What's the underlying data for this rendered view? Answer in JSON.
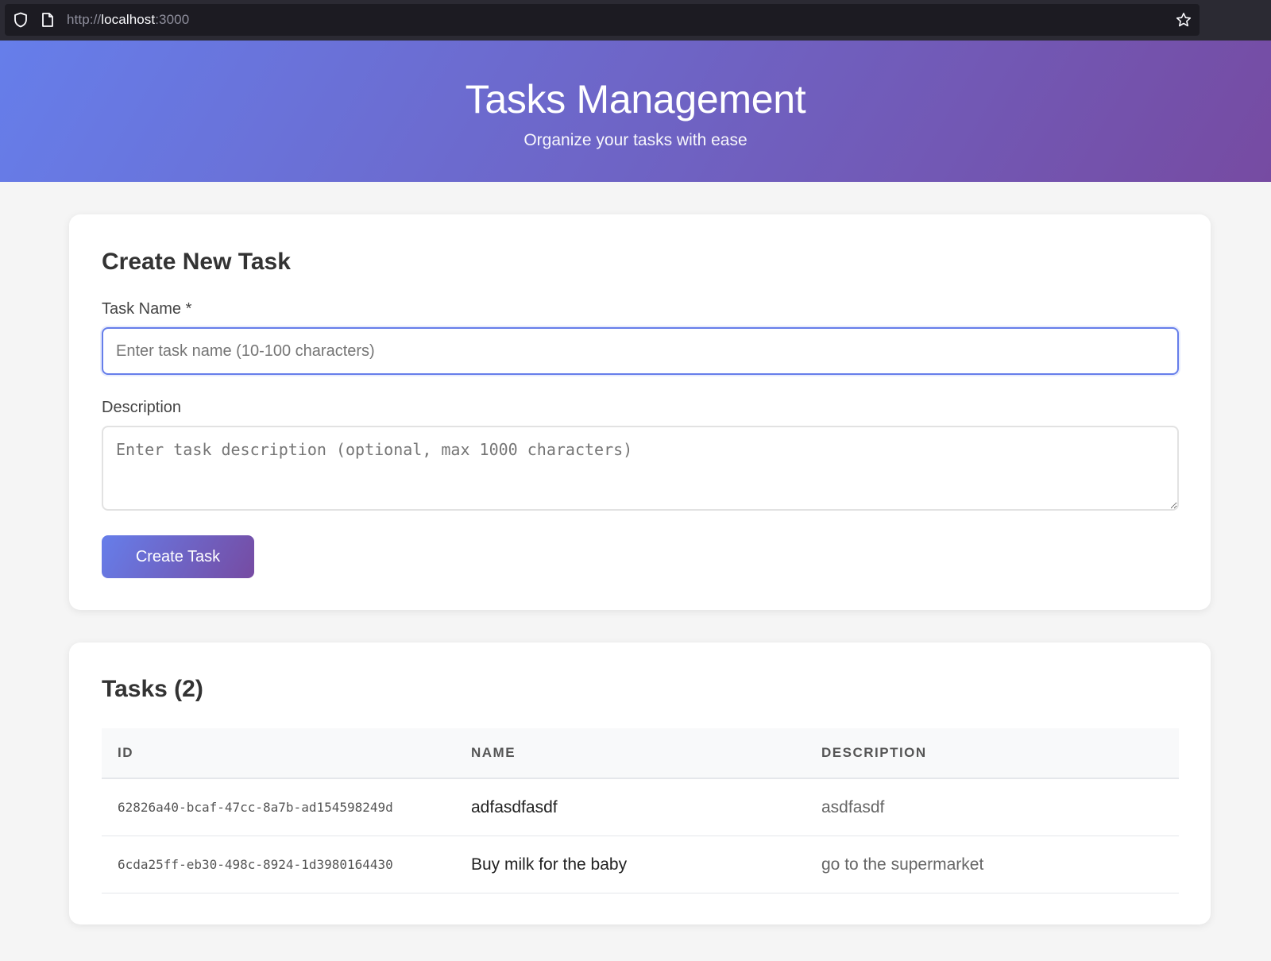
{
  "browser": {
    "url_scheme": "http://",
    "url_host": "localhost",
    "url_port": ":3000"
  },
  "header": {
    "title": "Tasks Management",
    "subtitle": "Organize your tasks with ease"
  },
  "create_form": {
    "heading": "Create New Task",
    "name_label": "Task Name *",
    "name_placeholder": "Enter task name (10-100 characters)",
    "name_value": "",
    "description_label": "Description",
    "description_placeholder": "Enter task description (optional, max 1000 characters)",
    "description_value": "",
    "submit_label": "Create Task"
  },
  "tasks": {
    "heading": "Tasks (2)",
    "columns": [
      "ID",
      "NAME",
      "DESCRIPTION"
    ],
    "rows": [
      {
        "id": "62826a40-bcaf-47cc-8a7b-ad154598249d",
        "name": "adfasdfasdf",
        "description": "asdfasdf"
      },
      {
        "id": "6cda25ff-eb30-498c-8924-1d3980164430",
        "name": "Buy milk for the baby",
        "description": "go to the supermarket"
      }
    ]
  },
  "icons": {
    "shield": "shield-icon",
    "page": "page-icon",
    "star": "star-icon"
  },
  "colors": {
    "gradient_start": "#667eea",
    "gradient_end": "#764ba2"
  }
}
